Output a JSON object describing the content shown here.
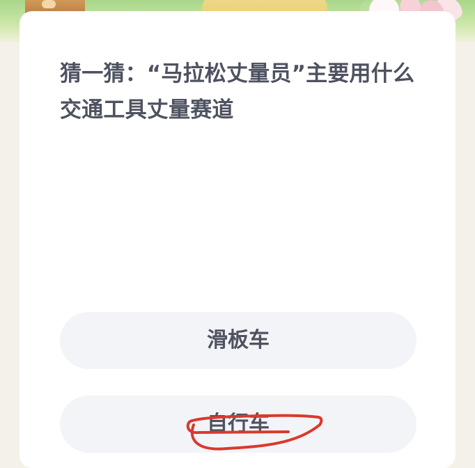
{
  "quiz": {
    "question": "猜一猜：“马拉松丈量员”主要用什么交通工具丈量赛道",
    "options": [
      {
        "label": "滑板车"
      },
      {
        "label": "自行车"
      }
    ]
  }
}
